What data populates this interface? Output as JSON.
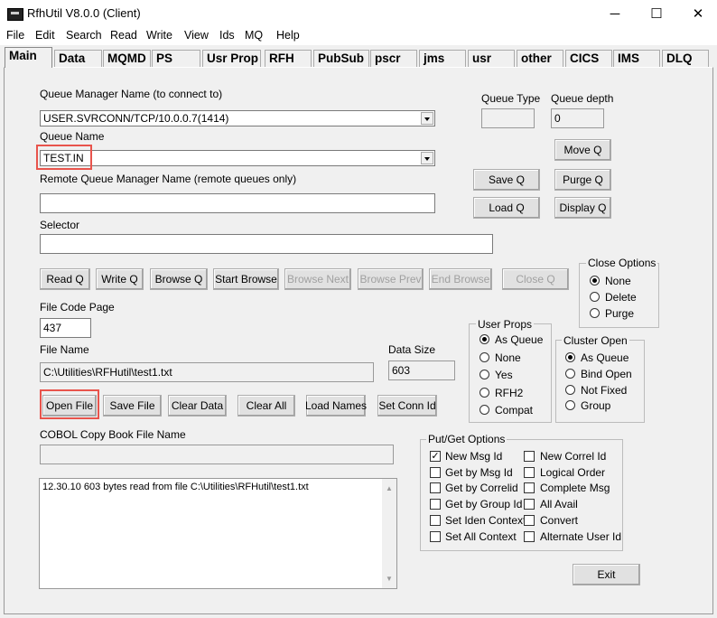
{
  "window": {
    "title": "RfhUtil V8.0.0 (Client)",
    "min": "─",
    "max": "☐",
    "close": "✕"
  },
  "menu": [
    "File",
    "Edit",
    "Search",
    "Read",
    "Write",
    "View",
    "Ids",
    "MQ",
    "Help"
  ],
  "tabs": [
    "Main",
    "Data",
    "MQMD",
    "PS",
    "Usr Prop",
    "RFH",
    "PubSub",
    "pscr",
    "jms",
    "usr",
    "other",
    "CICS",
    "IMS",
    "DLQ"
  ],
  "qm": {
    "label": "Queue Manager Name (to connect to)",
    "value": "USER.SVRCONN/TCP/10.0.0.7(1414)"
  },
  "queue_type": {
    "label": "Queue Type",
    "value": ""
  },
  "queue_depth": {
    "label": "Queue depth",
    "value": "0"
  },
  "queue": {
    "label": "Queue Name",
    "value": "TEST.IN"
  },
  "remote_qm": {
    "label": "Remote Queue Manager Name (remote queues only)",
    "value": ""
  },
  "selector": {
    "label": "Selector",
    "value": ""
  },
  "buttons": {
    "move_q": "Move Q",
    "save_q": "Save Q",
    "purge_q": "Purge Q",
    "load_q": "Load Q",
    "display_q": "Display Q",
    "read_q": "Read Q",
    "write_q": "Write Q",
    "browse_q": "Browse Q",
    "start_browse": "Start Browse",
    "browse_next": "Browse Next",
    "browse_prev": "Browse Prev",
    "end_browse": "End Browse",
    "close_q": "Close Q",
    "open_file": "Open File",
    "save_file": "Save File",
    "clear_data": "Clear Data",
    "clear_all": "Clear All",
    "load_names": "Load Names",
    "set_conn_id": "Set Conn Id",
    "exit": "Exit"
  },
  "close_options": {
    "title": "Close Options",
    "items": [
      "None",
      "Delete",
      "Purge"
    ],
    "selected": 0
  },
  "file_code_page": {
    "label": "File Code Page",
    "value": "437"
  },
  "user_props": {
    "title": "User Props",
    "items": [
      "As Queue",
      "None",
      "Yes",
      "RFH2",
      "Compat"
    ],
    "selected": 0
  },
  "cluster_open": {
    "title": "Cluster Open",
    "items": [
      "As Queue",
      "Bind Open",
      "Not Fixed",
      "Group"
    ],
    "selected": 0
  },
  "file_name": {
    "label": "File Name",
    "value": "C:\\Utilities\\RFHutil\\test1.txt"
  },
  "data_size": {
    "label": "Data Size",
    "value": "603"
  },
  "cobol": {
    "label": "COBOL Copy Book File Name",
    "value": ""
  },
  "put_get": {
    "title": "Put/Get Options",
    "left": [
      "New Msg Id",
      "Get by Msg Id",
      "Get by Correlid",
      "Get by Group Id",
      "Set Iden Context",
      "Set All Context"
    ],
    "left_checked": [
      true,
      false,
      false,
      false,
      false,
      false
    ],
    "right": [
      "New Correl Id",
      "Logical Order",
      "Complete Msg",
      "All Avail",
      "Convert",
      "Alternate User Id"
    ],
    "right_checked": [
      false,
      false,
      false,
      false,
      false,
      false
    ]
  },
  "log": "12.30.10 603 bytes read from file C:\\Utilities\\RFHutil\\test1.txt",
  "colors": {
    "highlight": "#e8544c"
  }
}
